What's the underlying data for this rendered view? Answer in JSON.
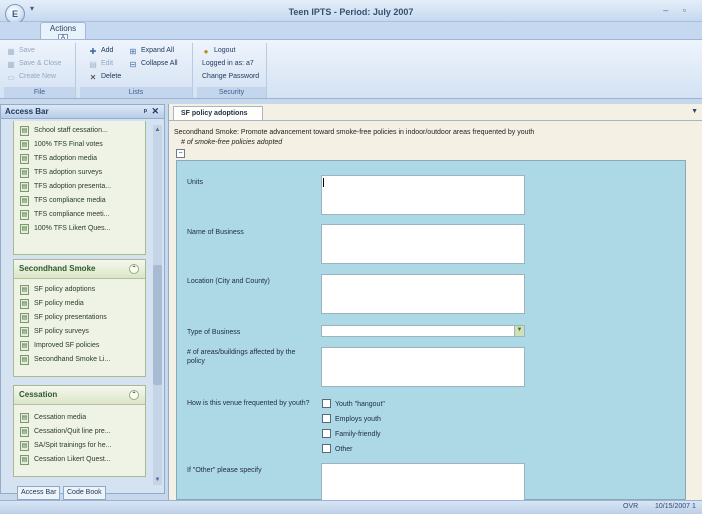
{
  "window": {
    "title": "Teen IPTS - Period: July 2007",
    "orb_label": "E",
    "qat_glyph": "▾",
    "controls": "– ▫"
  },
  "ribbon": {
    "tab": "Actions",
    "tab_keytip": "A",
    "groups": [
      {
        "title": "File",
        "items": [
          {
            "label": "Save",
            "icon": "save-icon",
            "enabled": false
          },
          {
            "label": "Save & Close",
            "icon": "save-close-icon",
            "enabled": false
          },
          {
            "label": "Create New",
            "icon": "create-new-icon",
            "enabled": false
          }
        ]
      },
      {
        "title": "Lists",
        "items": [
          {
            "label": "Add",
            "icon": "add-icon",
            "enabled": true
          },
          {
            "label": "Edit",
            "icon": "edit-icon",
            "enabled": false
          },
          {
            "label": "Delete",
            "icon": "delete-icon",
            "enabled": true
          },
          {
            "label": "Expand All",
            "icon": "expand-all-icon",
            "enabled": true
          },
          {
            "label": "Collapse All",
            "icon": "collapse-all-icon",
            "enabled": true
          }
        ]
      },
      {
        "title": "Security",
        "items": [
          {
            "label": "Logout",
            "icon": "logout-icon",
            "enabled": true
          },
          {
            "label": "Logged in as: a7",
            "enabled": true
          },
          {
            "label": "Change Password",
            "enabled": true
          }
        ]
      }
    ]
  },
  "access_bar": {
    "title": "Access Bar",
    "pin": "ᵖ",
    "close": "✕",
    "top_items": [
      "School staff cessation...",
      "100% TFS Final votes",
      "TFS adoption media",
      "TFS adoption surveys",
      "TFS adoption presenta...",
      "TFS compliance media",
      "TFS compliance meeti...",
      "100% TFS Likert Ques..."
    ],
    "sections": [
      {
        "title": "Secondhand Smoke",
        "items": [
          "SF policy adoptions",
          "SF policy media",
          "SF policy presentations",
          "SF policy surveys",
          "Improved SF policies",
          "Secondhand Smoke Li..."
        ]
      },
      {
        "title": "Cessation",
        "items": [
          "Cessation media",
          "Cessation/Quit line pre...",
          "SA/Spit trainings for he...",
          "Cessation Likert Quest..."
        ]
      }
    ],
    "bottom_tabs": [
      "Access Bar",
      "Code Book"
    ]
  },
  "document": {
    "tab": "SF policy adoptions",
    "subtitle": "Secondhand Smoke: Promote advancement toward smoke-free policies in indoor/outdoor areas frequented by youth",
    "measure": "# of smoke-free policies adopted",
    "collapse_glyph": "−",
    "fields": {
      "units": "Units",
      "business_name": "Name of Business",
      "location": "Location (City and County)",
      "business_type": "Type of Business",
      "areas_affected": "# of areas/buildings affected by the policy",
      "venue_question": "How is this venue frequented by youth?",
      "other_specify": "If \"Other\" please specify"
    },
    "venue_options": [
      "Youth \"hangout\"",
      "Employs youth",
      "Family-friendly",
      "Other"
    ]
  },
  "status": {
    "mode": "OVR",
    "date": "10/15/2007 1"
  }
}
